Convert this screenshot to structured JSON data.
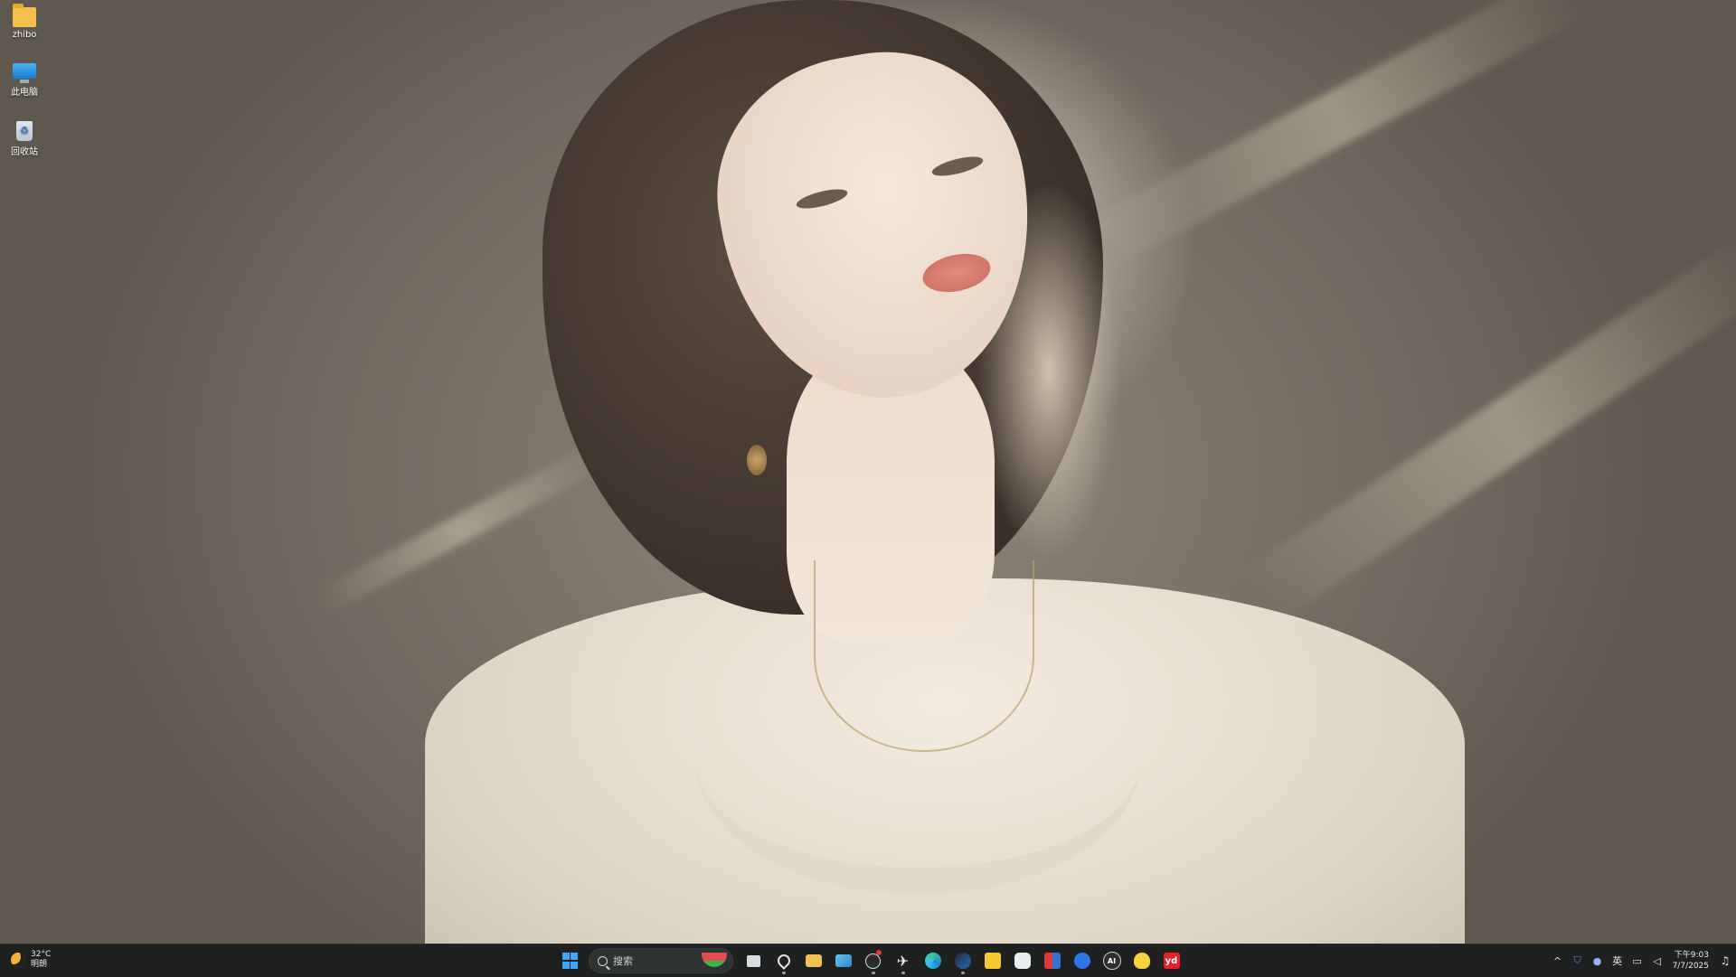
{
  "desktop": {
    "icons": [
      {
        "label": "zhibo",
        "icon": "folder-icon"
      },
      {
        "label": "此电脑",
        "icon": "this-pc-icon"
      },
      {
        "label": "回收站",
        "icon": "recycle-bin-icon"
      }
    ]
  },
  "taskbar": {
    "weather": {
      "temperature": "32°C",
      "condition": "明朗",
      "icon": "moon-icon"
    },
    "search": {
      "placeholder": "搜索"
    },
    "apps": [
      {
        "name": "start",
        "icon": "windows-start-icon"
      },
      {
        "name": "task-view",
        "icon": "task-view-icon"
      },
      {
        "name": "location",
        "icon": "location-pin-icon"
      },
      {
        "name": "file-explorer",
        "icon": "folder-icon"
      },
      {
        "name": "photos",
        "icon": "photos-icon"
      },
      {
        "name": "app-red-badge",
        "icon": "github-icon"
      },
      {
        "name": "feather",
        "icon": "feather-icon"
      },
      {
        "name": "edge",
        "icon": "edge-browser-icon"
      },
      {
        "name": "steam",
        "icon": "steam-icon"
      },
      {
        "name": "yellow-app",
        "icon": "yellow-app-icon"
      },
      {
        "name": "gamepad",
        "icon": "gamepad-icon"
      },
      {
        "name": "red-blue-app",
        "icon": "shield-app-icon"
      },
      {
        "name": "blue-app",
        "icon": "blue-app-icon"
      },
      {
        "name": "ai-app",
        "icon": "ai-app-icon"
      },
      {
        "name": "duck-app",
        "icon": "duck-icon"
      },
      {
        "name": "youdao",
        "icon": "youdao-icon"
      }
    ],
    "app_labels": {
      "ai": "AI",
      "youdao": "yd"
    },
    "tray": {
      "language": "英",
      "time": "下午9:03",
      "date": "7/7/2025"
    }
  },
  "colors": {
    "taskbar_bg": "#1f2121",
    "accent_blue": "#3fa7f5"
  }
}
